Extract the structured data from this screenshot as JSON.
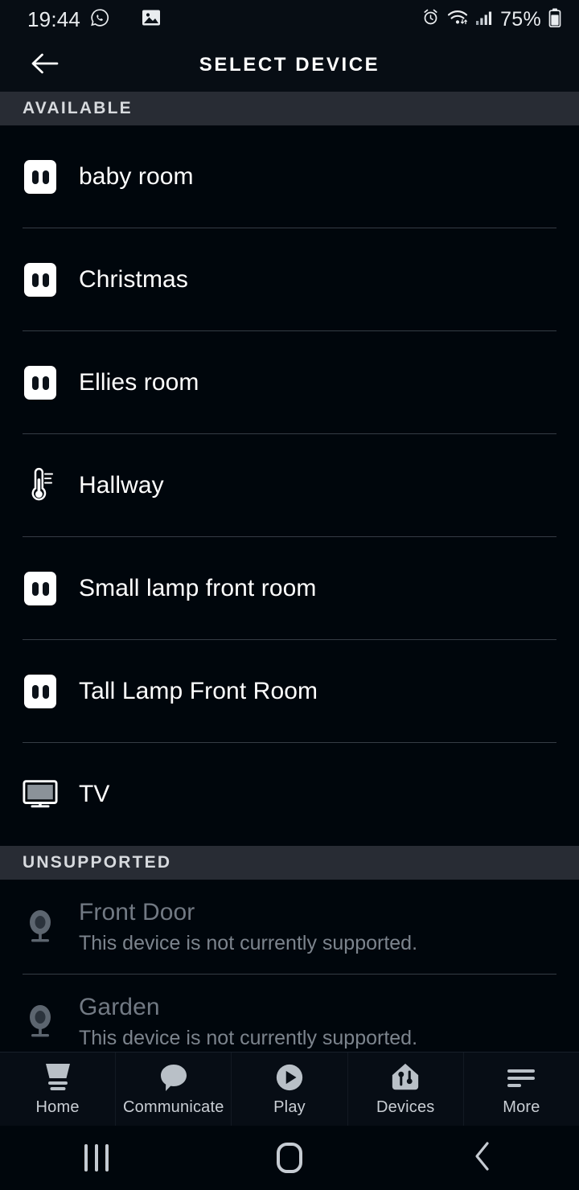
{
  "statusbar": {
    "time": "19:44",
    "battery_percent": "75%",
    "icons": [
      "whatsapp-icon",
      "photo-icon",
      "alarm-icon",
      "wifi-icon",
      "signal-icon",
      "battery-icon"
    ]
  },
  "header": {
    "title": "SELECT DEVICE",
    "back_icon": "back-arrow-icon"
  },
  "sections": [
    {
      "title": "AVAILABLE",
      "items": [
        {
          "label": "baby room",
          "icon": "plug-icon"
        },
        {
          "label": "Christmas",
          "icon": "plug-icon"
        },
        {
          "label": "Ellies room",
          "icon": "plug-icon"
        },
        {
          "label": "Hallway",
          "icon": "thermometer-icon"
        },
        {
          "label": "Small lamp front room",
          "icon": "plug-icon"
        },
        {
          "label": "Tall Lamp Front Room",
          "icon": "plug-icon"
        },
        {
          "label": "TV",
          "icon": "tv-icon"
        }
      ]
    },
    {
      "title": "UNSUPPORTED",
      "items": [
        {
          "label": "Front Door",
          "icon": "camera-icon",
          "subtitle": "This device is not currently supported."
        },
        {
          "label": "Garden",
          "icon": "camera-icon",
          "subtitle": "This device is not currently supported."
        }
      ]
    }
  ],
  "bottom_nav": [
    {
      "label": "Home",
      "icon": "home-icon"
    },
    {
      "label": "Communicate",
      "icon": "speech-bubble-icon"
    },
    {
      "label": "Play",
      "icon": "play-circle-icon"
    },
    {
      "label": "Devices",
      "icon": "devices-house-icon"
    },
    {
      "label": "More",
      "icon": "hamburger-menu-icon"
    }
  ],
  "android_nav": {
    "recents": "recents-icon",
    "home": "home-pill-icon",
    "back": "back-chevron-icon"
  },
  "colors": {
    "background": "#00060c",
    "section_header": "#282c34",
    "divider": "#353c45",
    "text_primary": "#ffffff",
    "text_dim": "#727a84",
    "nav_bg": "#070d15"
  }
}
